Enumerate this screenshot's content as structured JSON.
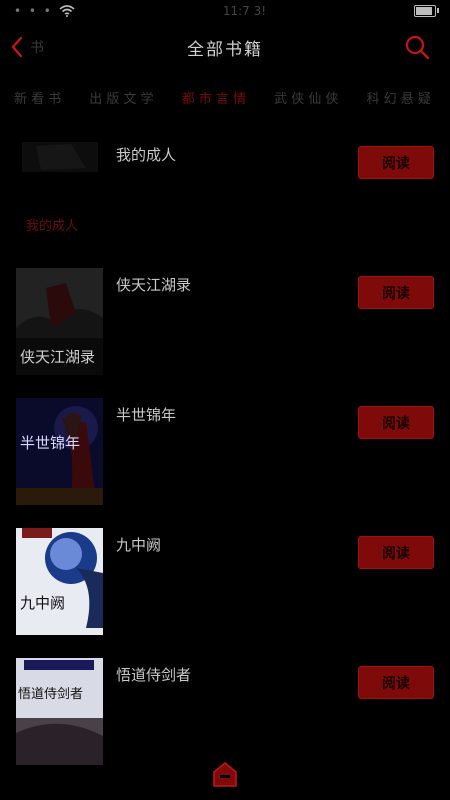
{
  "status": {
    "time": "11:7 3!"
  },
  "nav": {
    "back_label": "书",
    "title": "全部书籍"
  },
  "tabs": [
    {
      "label": "新 看 书"
    },
    {
      "label": "出 版 文 学"
    },
    {
      "label": "都 市 言 情"
    },
    {
      "label": "武 侠 仙 侠"
    },
    {
      "label": "科 幻 悬 疑"
    }
  ],
  "books": [
    {
      "title": "我的成人",
      "button": "阅读",
      "cover_text": "我的成人"
    },
    {
      "title": "侠天江湖录",
      "button": "阅读",
      "cover_text": "侠天江湖录"
    },
    {
      "title": "半世锦年",
      "button": "阅读",
      "cover_text": "半世锦年"
    },
    {
      "title": "九中阙",
      "button": "阅读",
      "cover_text": "九中阙"
    },
    {
      "title": "悟道侍剑者",
      "button": "阅读",
      "cover_text": "悟道侍剑者"
    }
  ],
  "colors": {
    "accent": "#c41414",
    "button_bg": "#7e0a0a",
    "background": "#000000"
  }
}
